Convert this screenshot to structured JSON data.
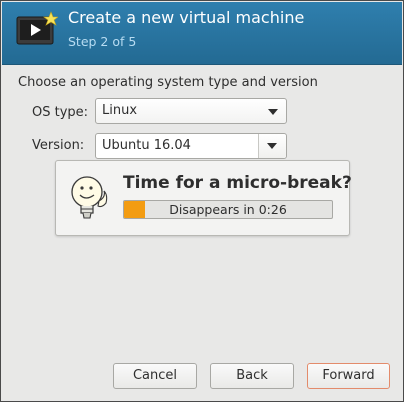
{
  "header": {
    "title": "Create a new virtual machine",
    "subtitle": "Step 2 of 5"
  },
  "main": {
    "prompt": "Choose an operating system type and version",
    "os_type": {
      "label": "OS type:",
      "value": "Linux"
    },
    "version": {
      "label": "Version:",
      "value": "Ubuntu 16.04"
    }
  },
  "popup": {
    "title": "Time for a micro-break?",
    "progress_text": "Disappears in 0:26",
    "progress_fraction": 0.1
  },
  "footer": {
    "cancel_label": "Cancel",
    "back_label": "Back",
    "forward_label": "Forward"
  },
  "colors": {
    "header_bg": "#2a76a0",
    "progress_fill": "#f39c12",
    "forward_border": "#e38b6b"
  }
}
